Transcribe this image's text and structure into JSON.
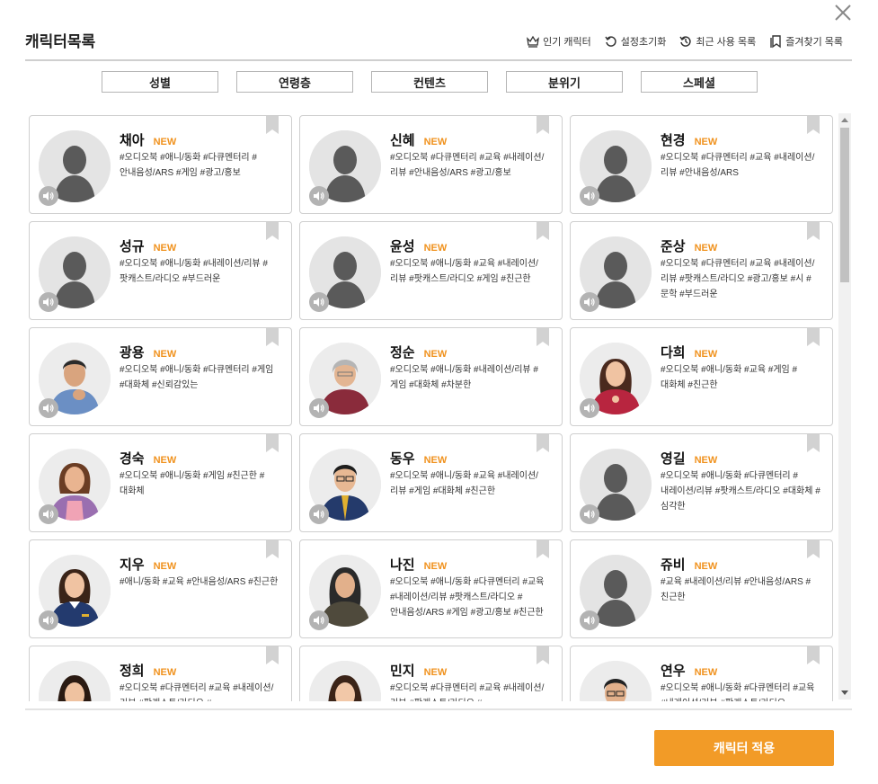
{
  "window": {
    "title": "캐릭터목록"
  },
  "toolbar": {
    "popular_label": "인기 캐릭터",
    "reset_label": "설정초기화",
    "recent_label": "최근 사용 목록",
    "favorites_label": "즐겨찾기 목록"
  },
  "filters": [
    {
      "label": "성별"
    },
    {
      "label": "연령층"
    },
    {
      "label": "컨텐츠"
    },
    {
      "label": "분위기"
    },
    {
      "label": "스페셜"
    }
  ],
  "cards": [
    {
      "name": "채아",
      "badge": "NEW",
      "tags": "#오디오북 #애니/동화 #다큐멘터리 #안내음성/ARS #게임 #광고/홍보",
      "avatar": "silhouette"
    },
    {
      "name": "신혜",
      "badge": "NEW",
      "tags": "#오디오북 #다큐멘터리 #교육 #내레이션/리뷰 #안내음성/ARS #광고/홍보",
      "avatar": "silhouette"
    },
    {
      "name": "현경",
      "badge": "NEW",
      "tags": "#오디오북 #다큐멘터리 #교육 #내레이션/리뷰 #안내음성/ARS",
      "avatar": "silhouette"
    },
    {
      "name": "성규",
      "badge": "NEW",
      "tags": "#오디오북 #애니/동화 #내레이션/리뷰 #팟캐스트/라디오 #부드러운",
      "avatar": "silhouette"
    },
    {
      "name": "윤성",
      "badge": "NEW",
      "tags": "#오디오북 #애니/동화 #교육 #내레이션/리뷰 #팟캐스트/라디오 #게임 #친근한",
      "avatar": "silhouette"
    },
    {
      "name": "준상",
      "badge": "NEW",
      "tags": "#오디오북 #다큐멘터리 #교육 #내레이션/리뷰 #팟캐스트/라디오 #광고/홍보 #시 #문학 #부드러운",
      "avatar": "silhouette"
    },
    {
      "name": "광용",
      "badge": "NEW",
      "tags": "#오디오북 #애니/동화 #다큐멘터리 #게임 #대화체 #신뢰감있는",
      "avatar": "man-blue-shirt"
    },
    {
      "name": "정순",
      "badge": "NEW",
      "tags": "#오디오북 #애니/동화 #내레이션/리뷰 #게임 #대화체 #차분한",
      "avatar": "elderly-woman"
    },
    {
      "name": "다희",
      "badge": "NEW",
      "tags": "#오디오북 #애니/동화 #교육 #게임 #대화체 #친근한",
      "avatar": "woman-red"
    },
    {
      "name": "경숙",
      "badge": "NEW",
      "tags": "#오디오북 #애니/동화 #게임 #친근한 #대화체",
      "avatar": "woman-apron"
    },
    {
      "name": "동우",
      "badge": "NEW",
      "tags": "#오디오북 #애니/동화 #교육 #내레이션/리뷰 #게임 #대화체 #친근한",
      "avatar": "man-suit-glasses"
    },
    {
      "name": "영길",
      "badge": "NEW",
      "tags": "#오디오북 #애니/동화 #다큐멘터리 #내레이션/리뷰 #팟캐스트/라디오 #대화체 #심각한",
      "avatar": "silhouette"
    },
    {
      "name": "지우",
      "badge": "NEW",
      "tags": "#애니/동화 #교육 #안내음성/ARS #친근한",
      "avatar": "woman-uniform"
    },
    {
      "name": "나진",
      "badge": "NEW",
      "tags": "#오디오북 #애니/동화 #다큐멘터리 #교육 #내레이션/리뷰 #팟캐스트/라디오 #안내음성/ARS #게임 #광고/홍보 #친근한",
      "avatar": "man-long-hair"
    },
    {
      "name": "쥬비",
      "badge": "NEW",
      "tags": "#교육 #내레이션/리뷰 #안내음성/ARS #친근한",
      "avatar": "silhouette"
    },
    {
      "name": "정희",
      "badge": "NEW",
      "tags": "#오디오북 #다큐멘터리 #교육 #내레이션/리뷰 #팟캐스트/라디오 #",
      "avatar": "woman-dark-hair"
    },
    {
      "name": "민지",
      "badge": "NEW",
      "tags": "#오디오북 #다큐멘터리 #교육 #내레이션/리뷰 #팟캐스트/라디오 #",
      "avatar": "woman-young"
    },
    {
      "name": "연우",
      "badge": "NEW",
      "tags": "#오디오북 #애니/동화 #다큐멘터리 #교육 #내레이션/리뷰 #팟캐스트/라디오",
      "avatar": "man-glasses"
    }
  ],
  "footer": {
    "apply_label": "캐릭터 적용"
  },
  "colors": {
    "accent": "#f29b27",
    "new_badge": "#f0921e",
    "border": "#cfcfcf"
  }
}
